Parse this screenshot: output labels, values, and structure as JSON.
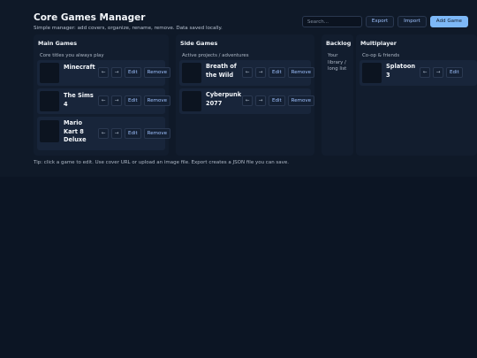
{
  "header": {
    "title": "Core Games Manager",
    "subtitle": "Simple manager: add covers, organize, rename, remove. Data saved locally."
  },
  "toolbar": {
    "search_placeholder": "Search...",
    "export_label": "Export",
    "import_label": "Import",
    "add_label": "Add Game"
  },
  "card_actions": {
    "left": "←",
    "right": "→",
    "edit": "Edit",
    "remove": "Remove"
  },
  "columns": [
    {
      "title": "Main Games",
      "subtitle": "Core titles you always play",
      "games": [
        "Minecraft",
        "The Sims 4",
        "Mario Kart 8 Deluxe"
      ]
    },
    {
      "title": "Side Games",
      "subtitle": "Active projects / adventures",
      "games": [
        "Breath of the Wild",
        "Cyberpunk 2077"
      ]
    },
    {
      "title": "Backlog",
      "subtitle": "Your library / long list",
      "games": []
    },
    {
      "title": "Multiplayer",
      "subtitle": "Co-op & friends",
      "games": [
        "Splatoon 3"
      ]
    }
  ],
  "footer": {
    "tip": "Tip: click a game to edit. Use cover URL or upload an image file. Export creates a JSON file you can save."
  },
  "colors": {
    "accent": "#7db8f7",
    "background": "#0c1524",
    "panel": "#121d2e",
    "card": "#18253a"
  }
}
